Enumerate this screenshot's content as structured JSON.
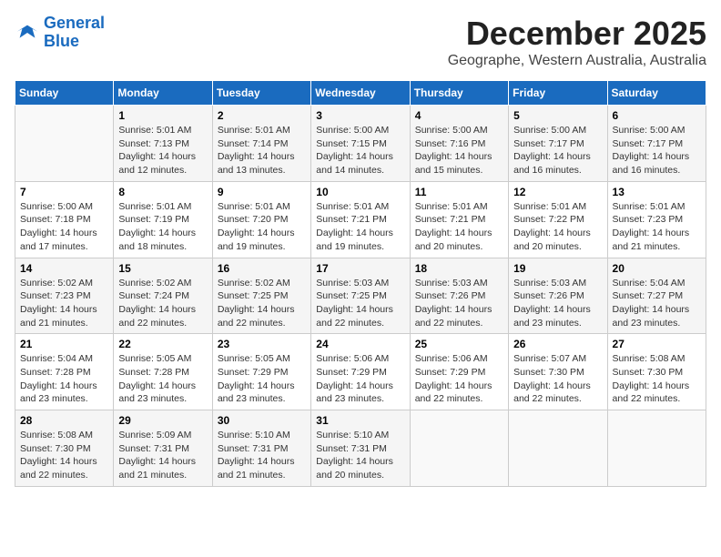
{
  "logo": {
    "line1": "General",
    "line2": "Blue"
  },
  "title": "December 2025",
  "subtitle": "Geographe, Western Australia, Australia",
  "days_of_week": [
    "Sunday",
    "Monday",
    "Tuesday",
    "Wednesday",
    "Thursday",
    "Friday",
    "Saturday"
  ],
  "weeks": [
    [
      {
        "day": "",
        "info": ""
      },
      {
        "day": "1",
        "info": "Sunrise: 5:01 AM\nSunset: 7:13 PM\nDaylight: 14 hours\nand 12 minutes."
      },
      {
        "day": "2",
        "info": "Sunrise: 5:01 AM\nSunset: 7:14 PM\nDaylight: 14 hours\nand 13 minutes."
      },
      {
        "day": "3",
        "info": "Sunrise: 5:00 AM\nSunset: 7:15 PM\nDaylight: 14 hours\nand 14 minutes."
      },
      {
        "day": "4",
        "info": "Sunrise: 5:00 AM\nSunset: 7:16 PM\nDaylight: 14 hours\nand 15 minutes."
      },
      {
        "day": "5",
        "info": "Sunrise: 5:00 AM\nSunset: 7:17 PM\nDaylight: 14 hours\nand 16 minutes."
      },
      {
        "day": "6",
        "info": "Sunrise: 5:00 AM\nSunset: 7:17 PM\nDaylight: 14 hours\nand 16 minutes."
      }
    ],
    [
      {
        "day": "7",
        "info": "Sunrise: 5:00 AM\nSunset: 7:18 PM\nDaylight: 14 hours\nand 17 minutes."
      },
      {
        "day": "8",
        "info": "Sunrise: 5:01 AM\nSunset: 7:19 PM\nDaylight: 14 hours\nand 18 minutes."
      },
      {
        "day": "9",
        "info": "Sunrise: 5:01 AM\nSunset: 7:20 PM\nDaylight: 14 hours\nand 19 minutes."
      },
      {
        "day": "10",
        "info": "Sunrise: 5:01 AM\nSunset: 7:21 PM\nDaylight: 14 hours\nand 19 minutes."
      },
      {
        "day": "11",
        "info": "Sunrise: 5:01 AM\nSunset: 7:21 PM\nDaylight: 14 hours\nand 20 minutes."
      },
      {
        "day": "12",
        "info": "Sunrise: 5:01 AM\nSunset: 7:22 PM\nDaylight: 14 hours\nand 20 minutes."
      },
      {
        "day": "13",
        "info": "Sunrise: 5:01 AM\nSunset: 7:23 PM\nDaylight: 14 hours\nand 21 minutes."
      }
    ],
    [
      {
        "day": "14",
        "info": "Sunrise: 5:02 AM\nSunset: 7:23 PM\nDaylight: 14 hours\nand 21 minutes."
      },
      {
        "day": "15",
        "info": "Sunrise: 5:02 AM\nSunset: 7:24 PM\nDaylight: 14 hours\nand 22 minutes."
      },
      {
        "day": "16",
        "info": "Sunrise: 5:02 AM\nSunset: 7:25 PM\nDaylight: 14 hours\nand 22 minutes."
      },
      {
        "day": "17",
        "info": "Sunrise: 5:03 AM\nSunset: 7:25 PM\nDaylight: 14 hours\nand 22 minutes."
      },
      {
        "day": "18",
        "info": "Sunrise: 5:03 AM\nSunset: 7:26 PM\nDaylight: 14 hours\nand 22 minutes."
      },
      {
        "day": "19",
        "info": "Sunrise: 5:03 AM\nSunset: 7:26 PM\nDaylight: 14 hours\nand 23 minutes."
      },
      {
        "day": "20",
        "info": "Sunrise: 5:04 AM\nSunset: 7:27 PM\nDaylight: 14 hours\nand 23 minutes."
      }
    ],
    [
      {
        "day": "21",
        "info": "Sunrise: 5:04 AM\nSunset: 7:28 PM\nDaylight: 14 hours\nand 23 minutes."
      },
      {
        "day": "22",
        "info": "Sunrise: 5:05 AM\nSunset: 7:28 PM\nDaylight: 14 hours\nand 23 minutes."
      },
      {
        "day": "23",
        "info": "Sunrise: 5:05 AM\nSunset: 7:29 PM\nDaylight: 14 hours\nand 23 minutes."
      },
      {
        "day": "24",
        "info": "Sunrise: 5:06 AM\nSunset: 7:29 PM\nDaylight: 14 hours\nand 23 minutes."
      },
      {
        "day": "25",
        "info": "Sunrise: 5:06 AM\nSunset: 7:29 PM\nDaylight: 14 hours\nand 22 minutes."
      },
      {
        "day": "26",
        "info": "Sunrise: 5:07 AM\nSunset: 7:30 PM\nDaylight: 14 hours\nand 22 minutes."
      },
      {
        "day": "27",
        "info": "Sunrise: 5:08 AM\nSunset: 7:30 PM\nDaylight: 14 hours\nand 22 minutes."
      }
    ],
    [
      {
        "day": "28",
        "info": "Sunrise: 5:08 AM\nSunset: 7:30 PM\nDaylight: 14 hours\nand 22 minutes."
      },
      {
        "day": "29",
        "info": "Sunrise: 5:09 AM\nSunset: 7:31 PM\nDaylight: 14 hours\nand 21 minutes."
      },
      {
        "day": "30",
        "info": "Sunrise: 5:10 AM\nSunset: 7:31 PM\nDaylight: 14 hours\nand 21 minutes."
      },
      {
        "day": "31",
        "info": "Sunrise: 5:10 AM\nSunset: 7:31 PM\nDaylight: 14 hours\nand 20 minutes."
      },
      {
        "day": "",
        "info": ""
      },
      {
        "day": "",
        "info": ""
      },
      {
        "day": "",
        "info": ""
      }
    ]
  ]
}
